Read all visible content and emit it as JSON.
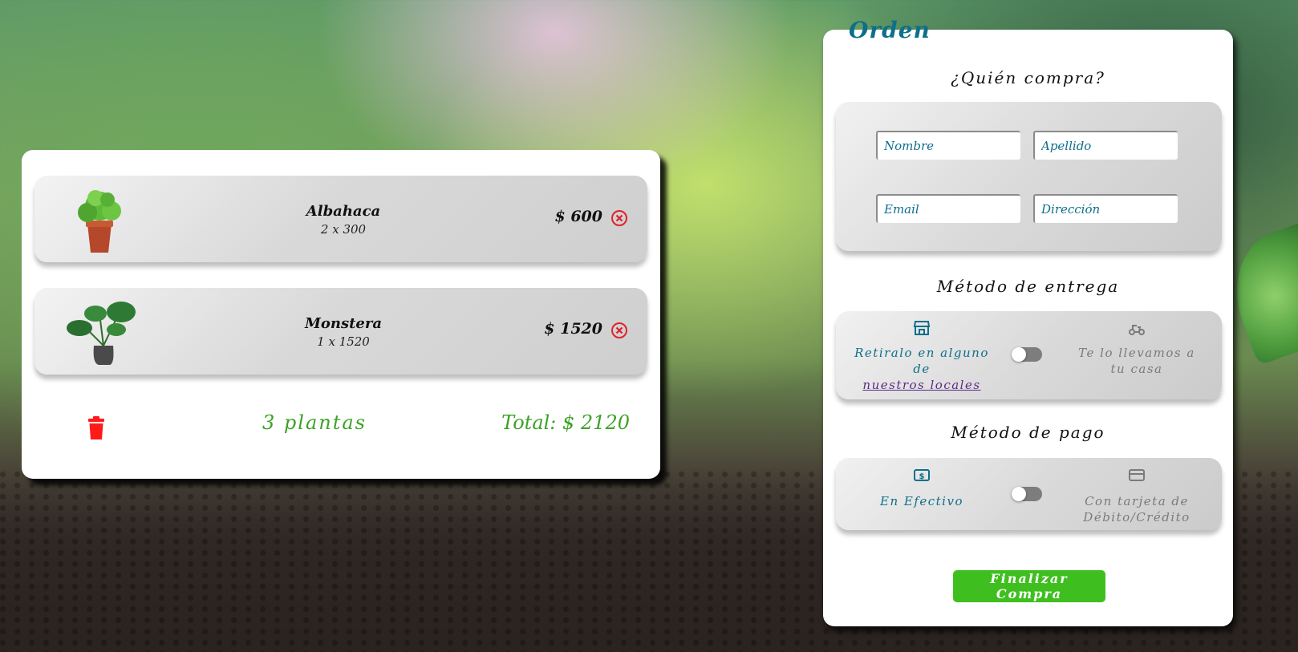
{
  "cart": {
    "items": [
      {
        "name": "Albahaca",
        "qty": "2 x 300",
        "price": "$ 600",
        "image": "basil-plant"
      },
      {
        "name": "Monstera",
        "qty": "1 x 1520",
        "price": "$ 1520",
        "image": "monstera-plant"
      }
    ],
    "count": "3 plantas",
    "total": "Total: $ 2120"
  },
  "order": {
    "title": "Orden",
    "buyer_title": "¿Quién compra?",
    "fields": {
      "nombre": "Nombre",
      "apellido": "Apellido",
      "email": "Email",
      "direccion": "Dirección"
    },
    "delivery": {
      "title": "Método de entrega",
      "left_text": "Retiralo en alguno de",
      "left_link": "nuestros locales",
      "right_text": "Te lo llevamos a tu casa",
      "left_icon": "store-icon",
      "right_icon": "scooter-icon"
    },
    "payment": {
      "title": "Método de pago",
      "left_text": "En Efectivo",
      "right_text": "Con tarjeta de Débito/Crédito",
      "left_icon": "cash-icon",
      "right_icon": "credit-card-icon"
    },
    "finish_label": "Finalizar Compra"
  },
  "colors": {
    "accent_teal": "#0e6f8a",
    "green": "#3aa324",
    "button_green": "#3fbf1f",
    "remove_red": "#e0202a"
  }
}
